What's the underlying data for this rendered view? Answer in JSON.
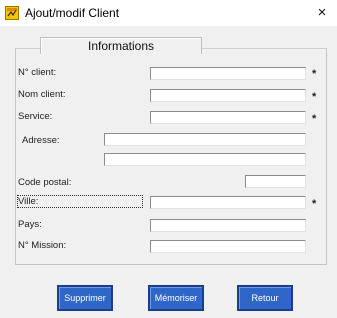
{
  "window": {
    "title": "Ajout/modif Client",
    "close_glyph": "×",
    "icon": "app-icon"
  },
  "group": {
    "title": "Informations"
  },
  "fields": [
    {
      "key": "num_client",
      "label": "N° client:",
      "value": "",
      "required": true
    },
    {
      "key": "nom_client",
      "label": "Nom client:",
      "value": "",
      "required": true
    },
    {
      "key": "service",
      "label": "Service:",
      "value": "",
      "required": true
    },
    {
      "key": "adresse",
      "label": "Adresse:",
      "value": "",
      "required": false
    },
    {
      "key": "adresse2",
      "label": "",
      "value": "",
      "required": false
    },
    {
      "key": "code_postal",
      "label": "Code postal:",
      "value": "",
      "required": false
    },
    {
      "key": "ville",
      "label": "Ville:",
      "value": "",
      "required": true
    },
    {
      "key": "pays",
      "label": "Pays:",
      "value": "",
      "required": false
    },
    {
      "key": "mission",
      "label": "N° Mission:",
      "value": "",
      "required": false
    }
  ],
  "required_marker": "*",
  "buttons": {
    "delete": "Supprimer",
    "save": "Mémoriser",
    "back": "Retour"
  },
  "colors": {
    "button_bg": "#2f67c8",
    "button_border": "#1c3e8a",
    "window_bg": "#f0f0f0"
  }
}
